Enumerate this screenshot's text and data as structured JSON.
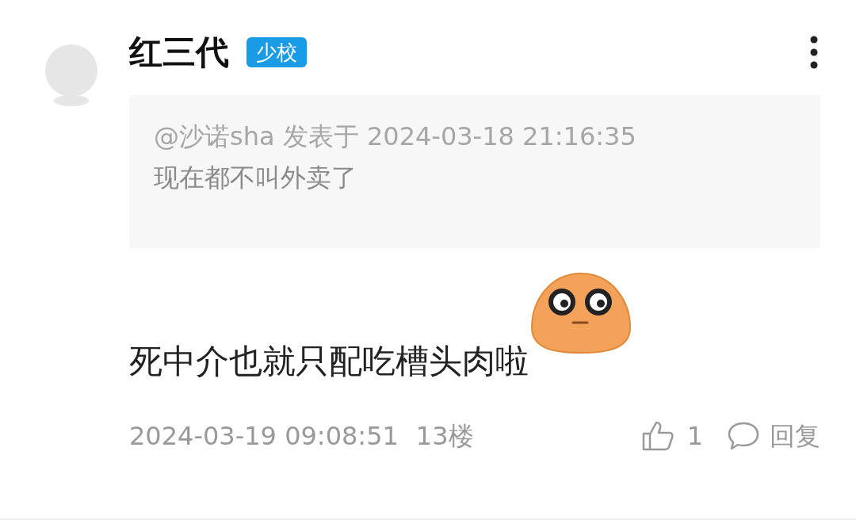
{
  "user": {
    "name": "红三代",
    "badge": "少校"
  },
  "quote": {
    "meta": "@沙诺sha 发表于 2024-03-18 21:16:35",
    "text": "现在都不叫外卖了"
  },
  "body": "死中介也就只配吃槽头肉啦",
  "footer": {
    "time": "2024-03-19 09:08:51",
    "floor": "13楼",
    "likes": "1",
    "reply": "回复"
  }
}
